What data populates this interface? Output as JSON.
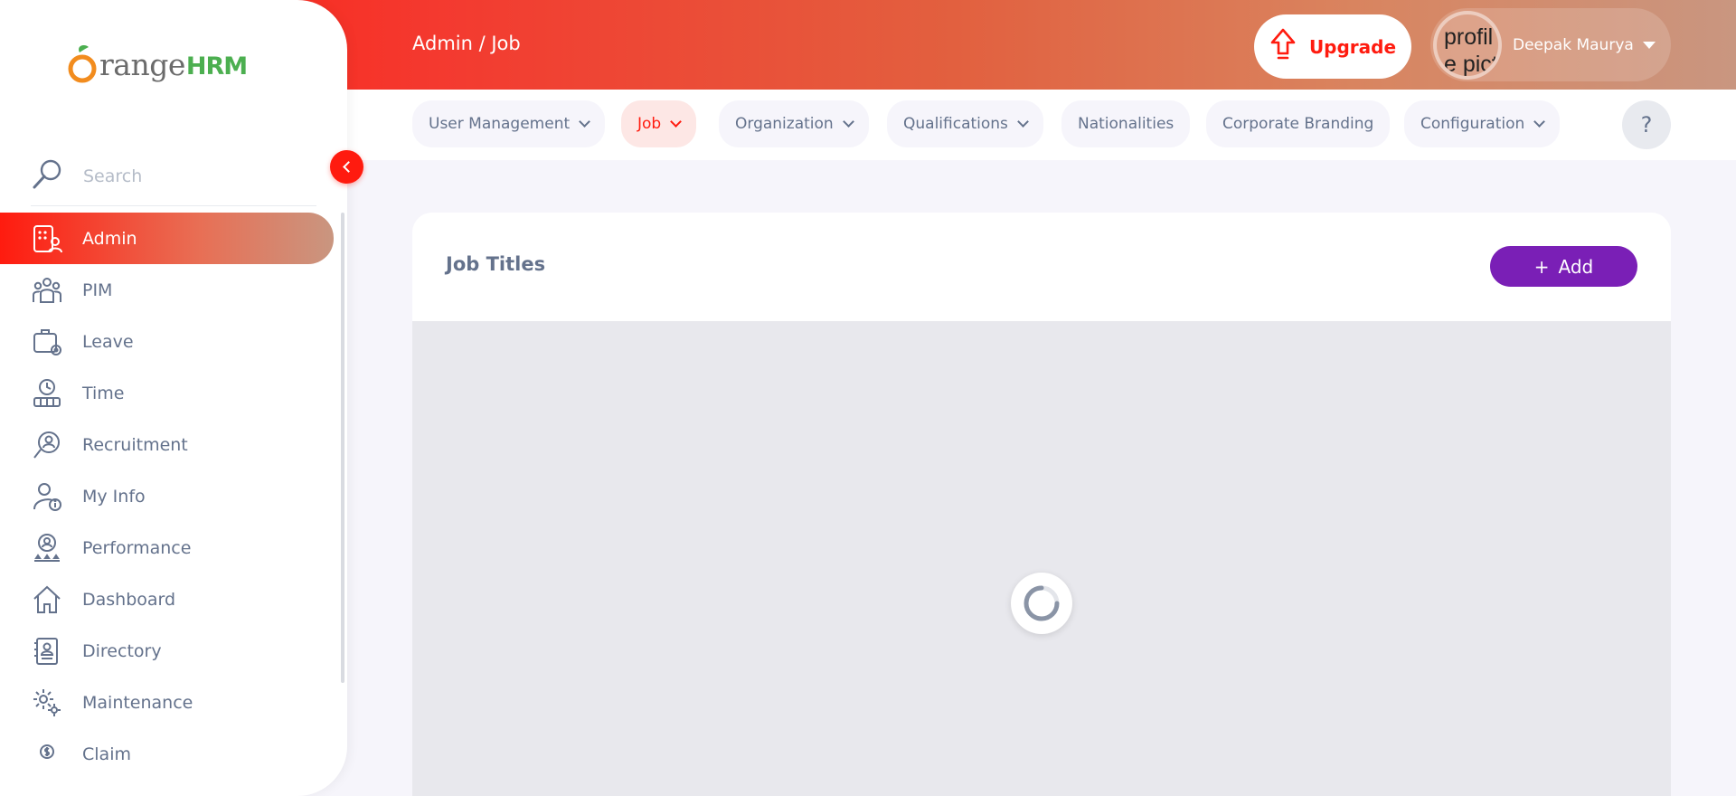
{
  "header": {
    "breadcrumb": "Admin / Job",
    "upgrade_label": "Upgrade",
    "avatar_alt": "profile picture",
    "user_name": "Deepak Maurya"
  },
  "subnav": {
    "tabs": [
      {
        "label": "User Management",
        "has_dropdown": true
      },
      {
        "label": "Job",
        "has_dropdown": true,
        "active": true
      },
      {
        "label": "Organization",
        "has_dropdown": true
      },
      {
        "label": "Qualifications",
        "has_dropdown": true
      },
      {
        "label": "Nationalities",
        "has_dropdown": false
      },
      {
        "label": "Corporate Branding",
        "has_dropdown": false
      },
      {
        "label": "Configuration",
        "has_dropdown": true
      }
    ],
    "help_label": "?"
  },
  "sidebar": {
    "logo_text": "range",
    "logo_suffix": "HRM",
    "search_placeholder": "Search",
    "items": [
      {
        "label": "Admin",
        "icon": "admin-icon",
        "active": true
      },
      {
        "label": "PIM",
        "icon": "pim-icon"
      },
      {
        "label": "Leave",
        "icon": "leave-icon"
      },
      {
        "label": "Time",
        "icon": "time-icon"
      },
      {
        "label": "Recruitment",
        "icon": "recruitment-icon"
      },
      {
        "label": "My Info",
        "icon": "my-info-icon"
      },
      {
        "label": "Performance",
        "icon": "performance-icon"
      },
      {
        "label": "Dashboard",
        "icon": "dashboard-icon"
      },
      {
        "label": "Directory",
        "icon": "directory-icon"
      },
      {
        "label": "Maintenance",
        "icon": "maintenance-icon"
      },
      {
        "label": "Claim",
        "icon": "claim-icon"
      }
    ]
  },
  "main": {
    "title": "Job Titles",
    "add_label": "Add",
    "add_icon": "+"
  },
  "colors": {
    "brand": "#ff1b0f",
    "accent_purple": "#7a1fb6",
    "text": "#64728c",
    "logo_green": "#4caf50",
    "logo_orange": "#f28c1e"
  }
}
